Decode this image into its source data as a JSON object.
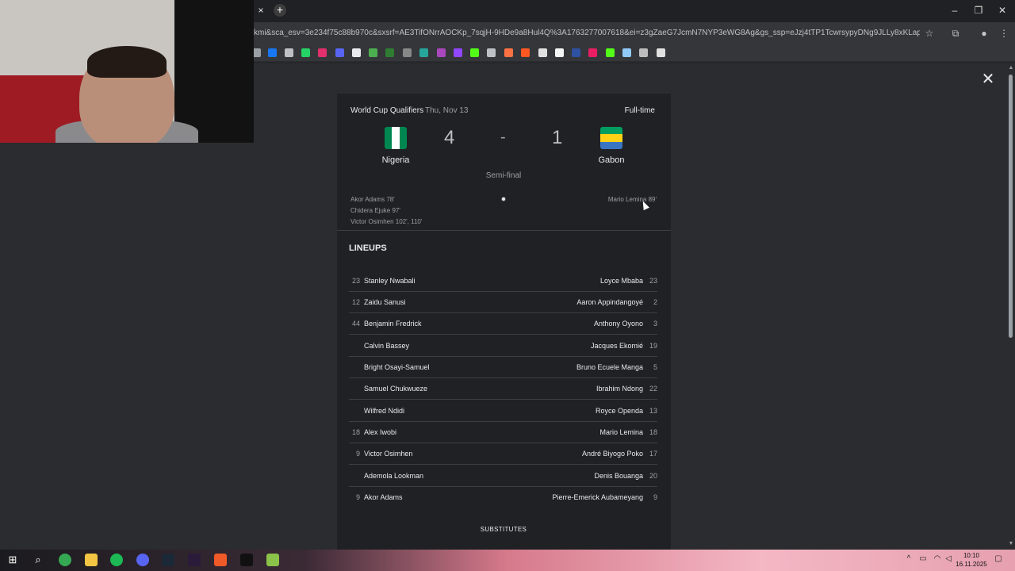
{
  "browser": {
    "url": "kmi&sca_esv=3e234f75c88b970c&sxsrf=AE3TifONrrAOCKp_7sqjH-9HDe9a8Hul4Q%3A1763277007618&ei=z3gZaeG7JcmN7NYP3eWG8Ag&gs_ssp=eJzj4tTP1TcwrsypyDNg9JLLy8xKLapMVMjNzMk5vE4...",
    "tab_close": "×",
    "new_tab": "+"
  },
  "overlay": {
    "close": "✕"
  },
  "match": {
    "competition": "World Cup Qualifiers",
    "date": "Thu, Nov 13",
    "status": "Full-time",
    "home": {
      "name": "Nigeria",
      "score": "4"
    },
    "away": {
      "name": "Gabon",
      "score": "1"
    },
    "separator": "-",
    "round": "Semi-final",
    "home_scorers": [
      "Akor Adams 78'",
      "Chidera Ejuke 97'",
      "Victor Osimhen 102', 110'"
    ],
    "away_scorers": [
      "Mario Lemina 89'"
    ]
  },
  "lineups": {
    "title": "LINEUPS",
    "rows": [
      {
        "home_num": "23",
        "home_player": "Stanley Nwabali",
        "away_player": "Loyce Mbaba",
        "away_num": "23"
      },
      {
        "home_num": "12",
        "home_player": "Zaidu Sanusi",
        "away_player": "Aaron Appindangoyé",
        "away_num": "2"
      },
      {
        "home_num": "44",
        "home_player": "Benjamin Fredrick",
        "away_player": "Anthony Oyono",
        "away_num": "3"
      },
      {
        "home_num": "",
        "home_player": "Calvin Bassey",
        "away_player": "Jacques Ekomié",
        "away_num": "19"
      },
      {
        "home_num": "",
        "home_player": "Bright Osayi-Samuel",
        "away_player": "Bruno Ecuele Manga",
        "away_num": "5"
      },
      {
        "home_num": "",
        "home_player": "Samuel Chukwueze",
        "away_player": "Ibrahim Ndong",
        "away_num": "22"
      },
      {
        "home_num": "",
        "home_player": "Wilfred Ndidi",
        "away_player": "Royce Openda",
        "away_num": "13"
      },
      {
        "home_num": "18",
        "home_player": "Alex Iwobi",
        "away_player": "Mario Lemina",
        "away_num": "18"
      },
      {
        "home_num": "9",
        "home_player": "Victor Osimhen",
        "away_player": "André Biyogo Poko",
        "away_num": "17"
      },
      {
        "home_num": "",
        "home_player": "Ademola Lookman",
        "away_player": "Denis Bouanga",
        "away_num": "20"
      },
      {
        "home_num": "9",
        "home_player": "Akor Adams",
        "away_player": "Pierre-Emerick Aubameyang",
        "away_num": "9"
      }
    ],
    "substitutes": "SUBSTITUTES"
  },
  "taskbar": {
    "time": "10:10",
    "date": "16.11.2025"
  },
  "colors": {
    "card_bg": "#202124",
    "page_bg": "#2b2c2f",
    "nigeria_green": "#008751",
    "gabon_green": "#009e60",
    "gabon_yellow": "#fcd116",
    "gabon_blue": "#3a75c4"
  }
}
